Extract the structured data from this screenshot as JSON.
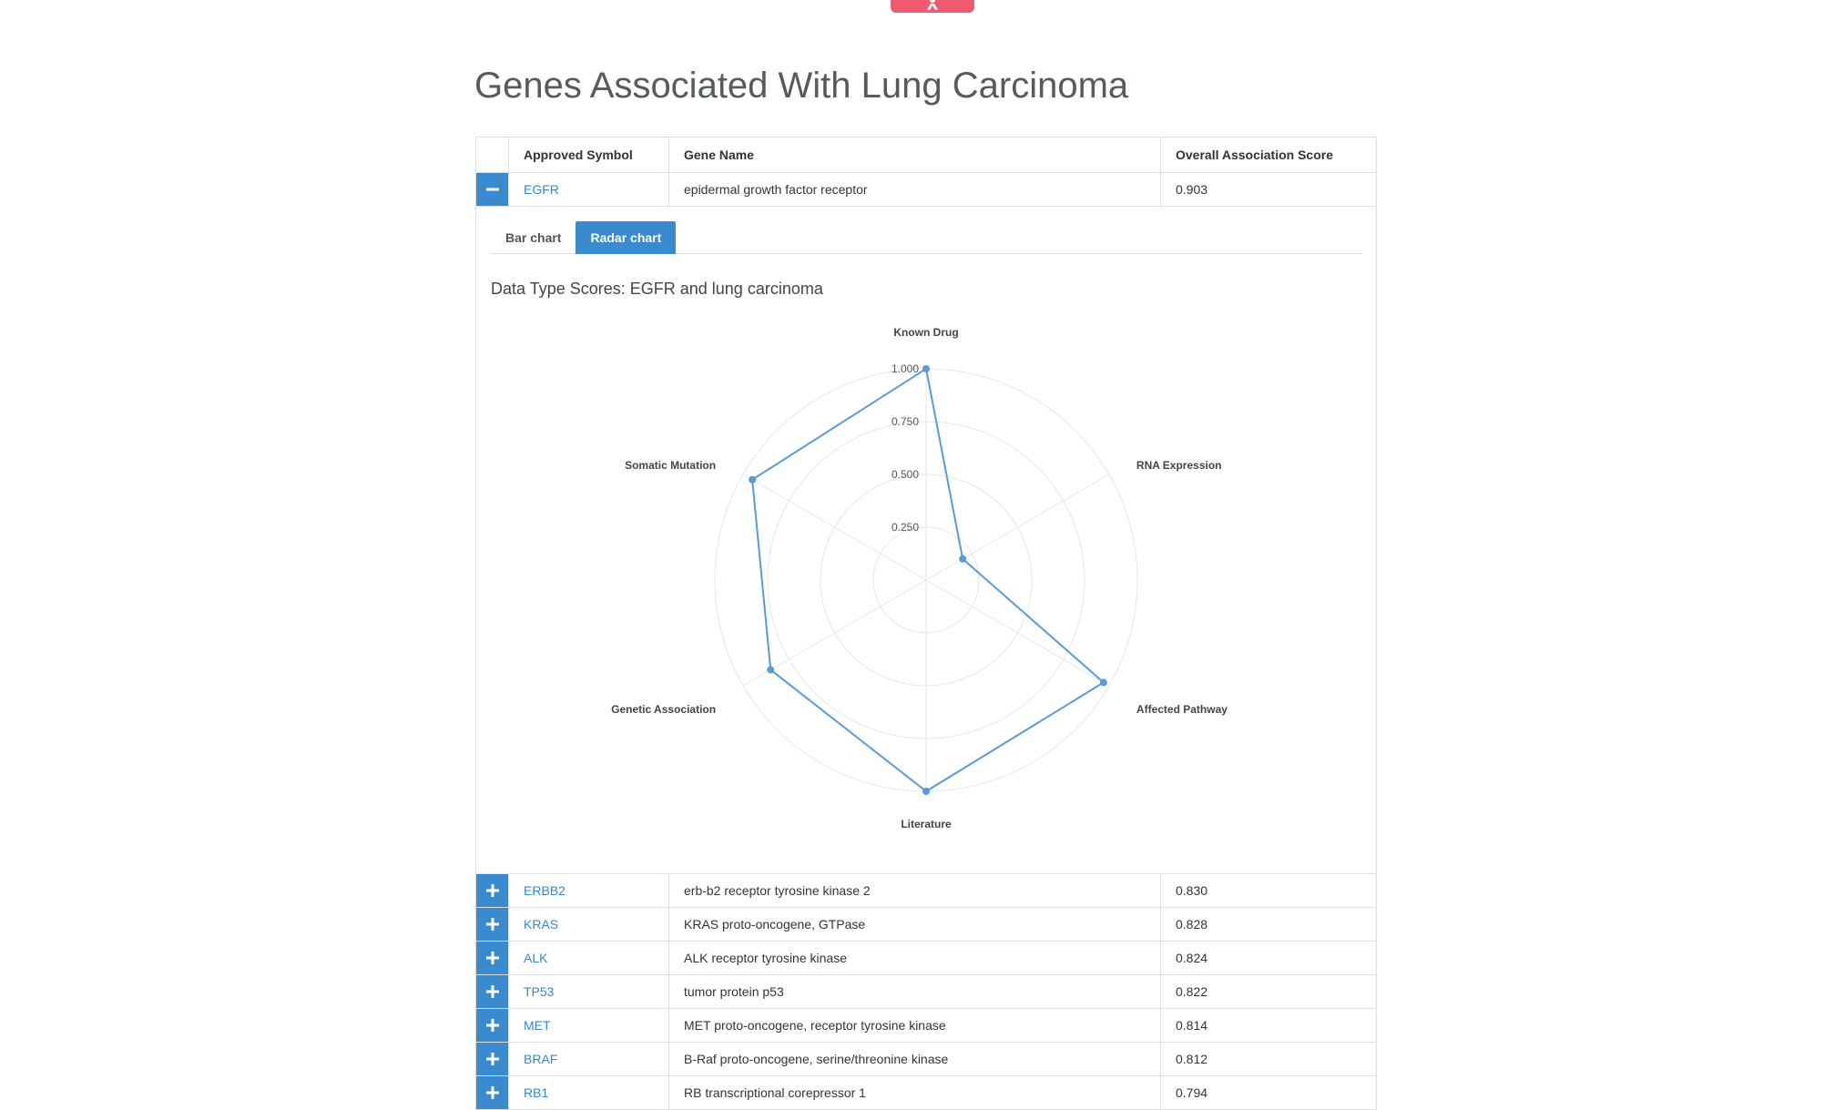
{
  "page": {
    "title": "Genes Associated With Lung Carcinoma"
  },
  "top_badge": {
    "icon": "person-icon",
    "color": "#f05a6e"
  },
  "table": {
    "headers": [
      "",
      "Approved Symbol",
      "Gene Name",
      "Overall Association Score"
    ],
    "expanded_row": {
      "symbol": "EGFR",
      "name": "epidermal growth factor receptor",
      "score": "0.903"
    },
    "rows": [
      {
        "symbol": "ERBB2",
        "name": "erb-b2 receptor tyrosine kinase 2",
        "score": "0.830"
      },
      {
        "symbol": "KRAS",
        "name": "KRAS proto-oncogene, GTPase",
        "score": "0.828"
      },
      {
        "symbol": "ALK",
        "name": "ALK receptor tyrosine kinase",
        "score": "0.824"
      },
      {
        "symbol": "TP53",
        "name": "tumor protein p53",
        "score": "0.822"
      },
      {
        "symbol": "MET",
        "name": "MET proto-oncogene, receptor tyrosine kinase",
        "score": "0.814"
      },
      {
        "symbol": "BRAF",
        "name": "B-Raf proto-oncogene, serine/threonine kinase",
        "score": "0.812"
      },
      {
        "symbol": "RB1",
        "name": "RB transcriptional corepressor 1",
        "score": "0.794"
      }
    ]
  },
  "tabs": [
    {
      "label": "Bar chart",
      "active": false
    },
    {
      "label": "Radar chart",
      "active": true
    }
  ],
  "chart_data": {
    "type": "radar",
    "title": "Data Type Scores: EGFR and lung carcinoma",
    "categories": [
      "Known Drug",
      "RNA Expression",
      "Affected Pathway",
      "Literature",
      "Genetic Association",
      "Somatic Mutation"
    ],
    "values": [
      1.0,
      0.2,
      0.97,
      1.0,
      0.85,
      0.95
    ],
    "rlim": [
      0,
      1
    ],
    "ticks": [
      "0.250",
      "0.500",
      "0.750",
      "1.000"
    ],
    "color": "#5a9bd5"
  },
  "colors": {
    "accent": "#3a8ad0",
    "link": "#3a86c8"
  }
}
